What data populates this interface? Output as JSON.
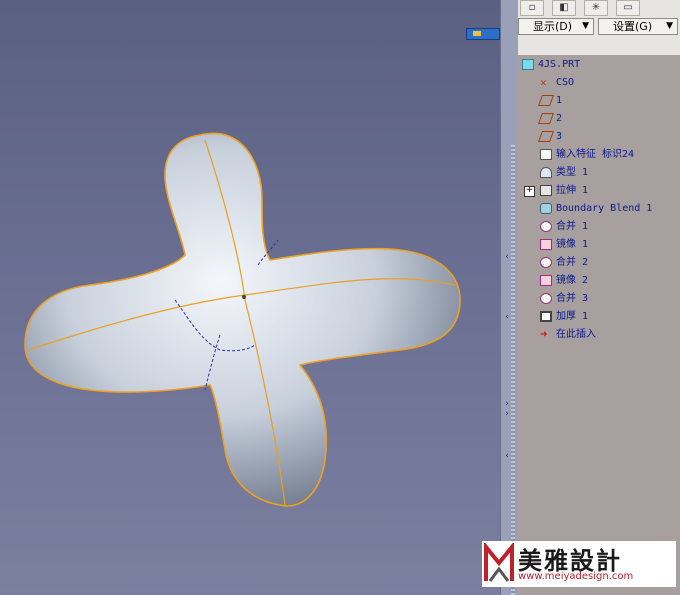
{
  "panel": {
    "toolbar_icons": [
      "tree-view-icon",
      "layers-icon",
      "star-icon",
      "folder-pencil-icon"
    ],
    "show_menu_label": "显示(D)",
    "settings_menu_label": "设置(G)"
  },
  "tree": {
    "items": [
      {
        "label": "4JS.PRT",
        "icon": "part-icon"
      },
      {
        "label": "CSO",
        "icon": "csys-icon"
      },
      {
        "label": "1",
        "icon": "datum-plane-icon"
      },
      {
        "label": "2",
        "icon": "datum-plane-icon"
      },
      {
        "label": "3",
        "icon": "datum-plane-icon"
      },
      {
        "label": "输入特征 标识24",
        "icon": "import-feature-icon"
      },
      {
        "label": "类型 1",
        "icon": "style-feature-icon"
      },
      {
        "label": "拉伸 1",
        "icon": "extrude-icon"
      },
      {
        "label": "Boundary Blend 1",
        "icon": "boundary-blend-icon"
      },
      {
        "label": "合并 1",
        "icon": "merge-icon"
      },
      {
        "label": "镜像 1",
        "icon": "mirror-icon"
      },
      {
        "label": "合并 2",
        "icon": "merge-icon"
      },
      {
        "label": "镜像 2",
        "icon": "mirror-icon"
      },
      {
        "label": "合并 3",
        "icon": "merge-icon"
      },
      {
        "label": "加厚 1",
        "icon": "thicken-icon"
      },
      {
        "label": "在此插入",
        "icon": "insert-here-icon"
      }
    ]
  },
  "logo": {
    "brand": "美雅設計",
    "url": "www.meiyadesign.com"
  },
  "colors": {
    "viewport_bg": "#5a6082",
    "panel_bg": "#a89f9f",
    "tree_text": "#0a1a8e",
    "model_edge": "#f0a020",
    "model_surface": "#c8d0dc"
  }
}
